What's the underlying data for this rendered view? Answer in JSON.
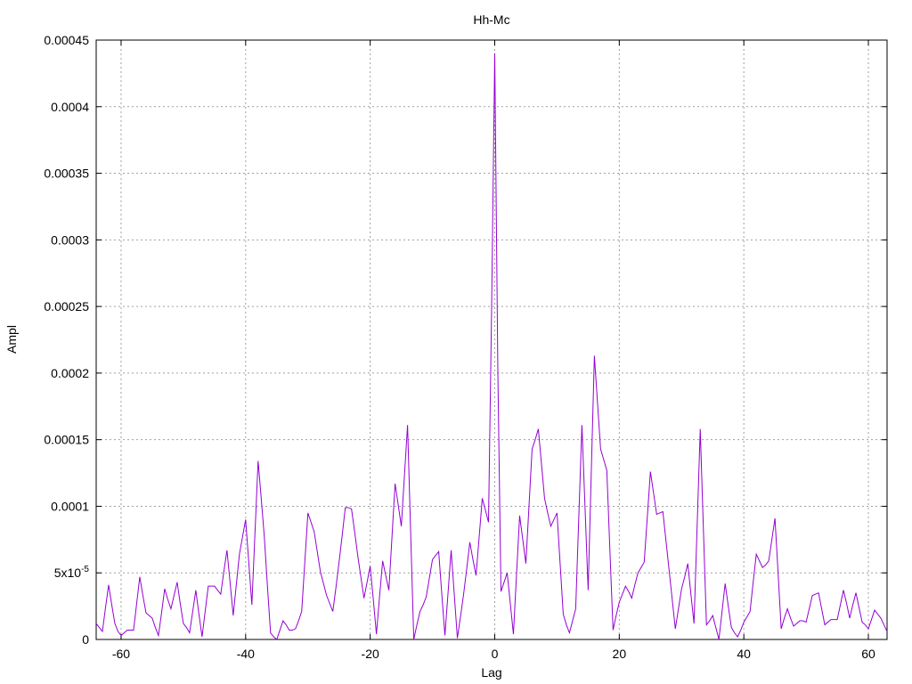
{
  "chart_data": {
    "type": "line",
    "title": "Hh-Mc",
    "xlabel": "Lag",
    "ylabel": "Ampl",
    "xlim": [
      -64,
      63
    ],
    "ylim": [
      0,
      0.00045
    ],
    "grid": true,
    "x_ticks": [
      -60,
      -40,
      -20,
      0,
      20,
      40,
      60
    ],
    "x_tick_labels": [
      "-60",
      "-40",
      "-20",
      "0",
      "20",
      "40",
      "60"
    ],
    "y_ticks": [
      0,
      5e-05,
      0.0001,
      0.00015,
      0.0002,
      0.00025,
      0.0003,
      0.00035,
      0.0004,
      0.00045
    ],
    "y_tick_labels": [
      "0",
      "5x10",
      "0.0001",
      "0.00015",
      "0.0002",
      "0.00025",
      "0.0003",
      "0.00035",
      "0.0004",
      "0.00045"
    ],
    "y_tick_exponent": "-5",
    "series": [
      {
        "color": "#9400d3",
        "x": [
          -64,
          -63.5,
          -63,
          -62.5,
          -62,
          -61.5,
          -61,
          -60.5,
          -60,
          -59.5,
          -59,
          -58.5,
          -58,
          -57.5,
          -57,
          -56.5,
          -56,
          -55.5,
          -55,
          -54.5,
          -54,
          -53.5,
          -53,
          -52.5,
          -52,
          -51.5,
          -51,
          -50.5,
          -50,
          -49.5,
          -49,
          -48.5,
          -48,
          -47.5,
          -47,
          -46.5,
          -46,
          -45.5,
          -45,
          -44.5,
          -44,
          -43.5,
          -43,
          -42.5,
          -42,
          -41.5,
          -41,
          -40.5,
          -40,
          -39.5,
          -39,
          -38.5,
          -38,
          -37.5,
          -37,
          -36.5,
          -36,
          -35.5,
          -35,
          -34.5,
          -34,
          -33.5,
          -33,
          -32.5,
          -32,
          -31.5,
          -31,
          -30.5,
          -30,
          -29.5,
          -29,
          -28.5,
          -28,
          -27.5,
          -27,
          -26.5,
          -26,
          -25.5,
          -25,
          -24.5,
          -24,
          -23.5,
          -23,
          -22.5,
          -22,
          -21.5,
          -21,
          -20.5,
          -20,
          -19.5,
          -19,
          -18.5,
          -18,
          -17.5,
          -17,
          -16.5,
          -16,
          -15.5,
          -15,
          -14.5,
          -14,
          -13.5,
          -13,
          -12.5,
          -12,
          -11.5,
          -11,
          -10.5,
          -10,
          -9.5,
          -9,
          -8.5,
          -8,
          -7.5,
          -7,
          -6.5,
          -6,
          -5.5,
          -5,
          -4.5,
          -4,
          -3.5,
          -3,
          -2.5,
          -2,
          -1.5,
          -1,
          -0.5,
          0,
          0.5,
          1,
          1.5,
          2,
          2.5,
          3,
          3.5,
          4,
          4.5,
          5,
          5.5,
          6,
          6.5,
          7,
          7.5,
          8,
          8.5,
          9,
          9.5,
          10,
          10.5,
          11,
          11.5,
          12,
          12.5,
          13,
          13.5,
          14,
          14.5,
          15,
          15.5,
          16,
          16.5,
          17,
          17.5,
          18,
          18.5,
          19,
          19.5,
          20,
          20.5,
          21,
          21.5,
          22,
          22.5,
          23,
          23.5,
          24,
          24.5,
          25,
          25.5,
          26,
          26.5,
          27,
          27.5,
          28,
          28.5,
          29,
          29.5,
          30,
          30.5,
          31,
          31.5,
          32,
          32.5,
          33,
          33.5,
          34,
          34.5,
          35,
          35.5,
          36,
          36.5,
          37,
          37.5,
          38,
          38.5,
          39,
          39.5,
          40,
          40.5,
          41,
          41.5,
          42,
          42.5,
          43,
          43.5,
          44,
          44.5,
          45,
          45.5,
          46,
          46.5,
          47,
          47.5,
          48,
          48.5,
          49,
          49.5,
          50,
          50.5,
          51,
          51.5,
          52,
          52.5,
          53,
          53.5,
          54,
          54.5,
          55,
          55.5,
          56,
          56.5,
          57,
          57.5,
          58,
          58.5,
          59,
          59.5,
          60,
          60.5,
          61,
          61.5,
          62,
          62.5,
          63
        ],
        "y": [
          1.2e-05,
          9e-06,
          6e-06,
          2.4e-05,
          4.1e-05,
          2.6e-05,
          1.2e-05,
          6e-06,
          3e-06,
          5e-06,
          7e-06,
          7e-06,
          7e-06,
          2.7e-05,
          4.7e-05,
          3.3e-05,
          2e-05,
          1.8e-05,
          1.6e-05,
          9e-06,
          3e-06,
          2e-05,
          3.8e-05,
          3e-05,
          2.3e-05,
          3.3e-05,
          4.3e-05,
          2.7e-05,
          1.2e-05,
          9e-06,
          5e-06,
          2.1e-05,
          3.7e-05,
          1.9e-05,
          2e-06,
          2.1e-05,
          4e-05,
          4e-05,
          4e-05,
          3.7e-05,
          3.4e-05,
          5.1e-05,
          6.7e-05,
          4.3e-05,
          1.8e-05,
          4.1e-05,
          6.4e-05,
          7.7e-05,
          9e-05,
          5.8e-05,
          2.6e-05,
          8e-05,
          0.000134,
          0.000106,
          7.7e-05,
          4e-05,
          5e-06,
          2e-06,
          0,
          7e-06,
          1.4e-05,
          1.1e-05,
          7e-06,
          7e-06,
          8e-06,
          1.4e-05,
          2.1e-05,
          5.8e-05,
          9.5e-05,
          8.8e-05,
          8.1e-05,
          6.6e-05,
          5.1e-05,
          4.2e-05,
          3.3e-05,
          2.7e-05,
          2.1e-05,
          3.9e-05,
          5.8e-05,
          7.8e-05,
          9.9e-05,
          9.9e-05,
          9.8e-05,
          8.1e-05,
          6.3e-05,
          4.7e-05,
          3.1e-05,
          4.3e-05,
          5.5e-05,
          3e-05,
          4e-06,
          3.2e-05,
          5.9e-05,
          4.8e-05,
          3.7e-05,
          7.7e-05,
          0.000117,
          0.000101,
          8.5e-05,
          0.000123,
          0.000161,
          8e-05,
          0,
          1.1e-05,
          2.1e-05,
          2.6e-05,
          3.2e-05,
          4.6e-05,
          6e-05,
          6.3e-05,
          6.6e-05,
          3.4e-05,
          3e-06,
          3.5e-05,
          6.7e-05,
          3.4e-05,
          1e-06,
          1.7e-05,
          3.4e-05,
          5.3e-05,
          7.3e-05,
          6e-05,
          4.8e-05,
          7.7e-05,
          0.000106,
          9.7e-05,
          8.8e-05,
          0.000249,
          0.00044,
          0.000201,
          3.6e-05,
          4.3e-05,
          5e-05,
          2.7e-05,
          4e-06,
          4.9e-05,
          9.3e-05,
          7.5e-05,
          5.7e-05,
          0.0001,
          0.000143,
          0.00015,
          0.000158,
          0.000132,
          0.000106,
          9.5e-05,
          8.5e-05,
          9e-05,
          9.5e-05,
          5.7e-05,
          1.9e-05,
          1.1e-05,
          5e-06,
          1.4e-05,
          2.3e-05,
          9.2e-05,
          0.000161,
          9.9e-05,
          3.7e-05,
          0.000125,
          0.000213,
          0.000178,
          0.000143,
          0.000135,
          0.000127,
          6.6e-05,
          7e-06,
          1.8e-05,
          2.8e-05,
          3.4e-05,
          4e-05,
          3.6e-05,
          3.1e-05,
          4.1e-05,
          5e-05,
          5.4e-05,
          5.8e-05,
          9.2e-05,
          0.000126,
          0.00011,
          9.4e-05,
          9.5e-05,
          9.6e-05,
          7.4e-05,
          5.2e-05,
          3e-05,
          8e-06,
          2.3e-05,
          3.8e-05,
          4.7e-05,
          5.7e-05,
          3.4e-05,
          1.2e-05,
          8.5e-05,
          0.000158,
          8.4e-05,
          1.1e-05,
          1.4e-05,
          1.8e-05,
          9e-06,
          0,
          2.1e-05,
          4.2e-05,
          2.5e-05,
          9e-06,
          5e-06,
          2e-06,
          7e-06,
          1.3e-05,
          1.7e-05,
          2.1e-05,
          4.3e-05,
          6.4e-05,
          5.9e-05,
          5.4e-05,
          5.6e-05,
          5.9e-05,
          7.5e-05,
          9.1e-05,
          5e-05,
          8e-06,
          1.6e-05,
          2.3e-05,
          1.6e-05,
          1e-05,
          1.2e-05,
          1.4e-05,
          1.4e-05,
          1.3e-05,
          2.3e-05,
          3.3e-05,
          3.4e-05,
          3.5e-05,
          2.3e-05,
          1.1e-05,
          1.3e-05,
          1.5e-05,
          1.5e-05,
          1.5e-05,
          2.6e-05,
          3.7e-05,
          2.7e-05,
          1.6e-05,
          2.6e-05,
          3.5e-05,
          2.4e-05,
          1.3e-05,
          1.1e-05,
          8e-06,
          1.5e-05,
          2.2e-05,
          1.9e-05,
          1.6e-05,
          1.1e-05,
          6e-06
        ]
      }
    ]
  }
}
